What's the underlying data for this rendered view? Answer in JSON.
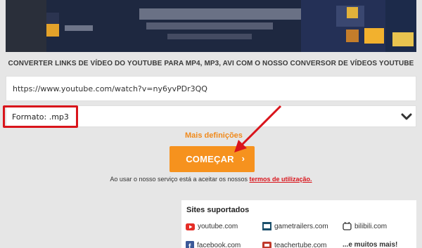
{
  "headline": "CONVERTER LINKS DE VÍDEO DO YOUTUBE PARA MP4, MP3, AVI COM O NOSSO CONVERSOR DE VÍDEOS YOUTUBE",
  "url_input": {
    "value": "https://www.youtube.com/watch?v=ny6yvPDr3QQ"
  },
  "format": {
    "label": "Formato: .mp3"
  },
  "more_settings": "Mais definições",
  "start_button": {
    "label": "COMEÇAR",
    "arrow": "›"
  },
  "terms": {
    "prefix": "Ao usar o nosso serviço está a aceitar os nossos ",
    "link": "termos de utilização."
  },
  "sites": {
    "title": "Sites suportados",
    "items": [
      {
        "name": "youtube.com",
        "icon": "youtube-icon"
      },
      {
        "name": "gametrailers.com",
        "icon": "gametrailers-icon"
      },
      {
        "name": "bilibili.com",
        "icon": "bilibili-icon"
      },
      {
        "name": "facebook.com",
        "icon": "facebook-icon"
      },
      {
        "name": "teachertube.com",
        "icon": "teachertube-icon"
      },
      {
        "name": "...e muitos mais!",
        "icon": ""
      }
    ]
  },
  "colors": {
    "accent": "#f6921e",
    "highlight": "#d9141b",
    "banner": "#1e2840"
  }
}
